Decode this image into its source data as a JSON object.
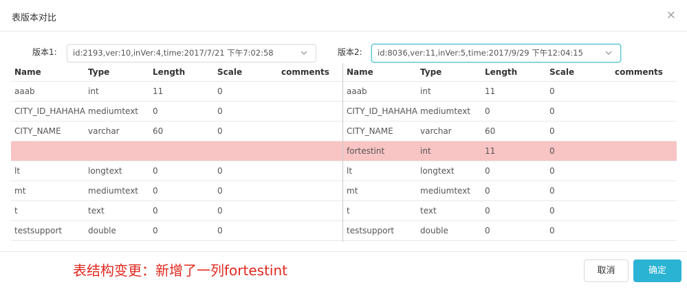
{
  "dialog": {
    "title": "表版本对比",
    "close_glyph": "×"
  },
  "left": {
    "label": "版本1:",
    "select_value": "id:2193,ver:10,inVer:4,time:2017/7/21 下午7:02:58",
    "columns": [
      "Name",
      "Type",
      "Length",
      "Scale",
      "comments"
    ],
    "rows": [
      [
        "aaab",
        "int",
        "11",
        "0"
      ],
      [
        "CITY_ID_HAHAHA",
        "mediumtext",
        "0",
        "0"
      ],
      [
        "CITY_NAME",
        "varchar",
        "60",
        "0"
      ],
      [
        "",
        "",
        "",
        ""
      ],
      [
        "lt",
        "longtext",
        "0",
        "0"
      ],
      [
        "mt",
        "mediumtext",
        "0",
        "0"
      ],
      [
        "t",
        "text",
        "0",
        "0"
      ],
      [
        "testsupport",
        "double",
        "0",
        "0"
      ]
    ]
  },
  "right": {
    "label": "版本2:",
    "select_value": "id:8036,ver:11,inVer:5,time:2017/9/29 下午12:04:15",
    "columns": [
      "Name",
      "Type",
      "Length",
      "Scale",
      "comments"
    ],
    "rows": [
      [
        "aaab",
        "int",
        "11",
        "0"
      ],
      [
        "CITY_ID_HAHAHA",
        "mediumtext",
        "0",
        "0"
      ],
      [
        "CITY_NAME",
        "varchar",
        "60",
        "0"
      ],
      [
        "fortestint",
        "int",
        "11",
        "0"
      ],
      [
        "lt",
        "longtext",
        "0",
        "0"
      ],
      [
        "mt",
        "mediumtext",
        "0",
        "0"
      ],
      [
        "t",
        "text",
        "0",
        "0"
      ],
      [
        "testsupport",
        "double",
        "0",
        "0"
      ]
    ]
  },
  "highlight_row_index": 3,
  "colors": {
    "diff_row": "#f9c4c4",
    "note_text": "#e0281e",
    "primary": "#2bb3d4"
  },
  "footer": {
    "note": "表结构变更：新增了一列fortestint",
    "cancel_label": "取消",
    "ok_label": "确定"
  }
}
